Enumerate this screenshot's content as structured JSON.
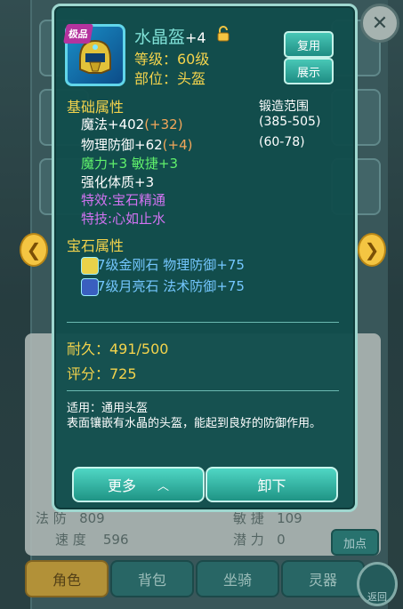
{
  "background": {
    "rows": [
      {
        "label": "法 防",
        "value": "809"
      },
      {
        "label": "速 度",
        "value": "596"
      },
      {
        "label": "敏 捷",
        "value": "109"
      },
      {
        "label": "潜 力",
        "value": "0"
      }
    ],
    "add_point_label": "加点",
    "tabs": [
      "角色",
      "背包",
      "坐骑",
      "灵器"
    ],
    "back_label": "返回"
  },
  "item": {
    "badge": "极品",
    "name": "水晶盔",
    "enhance": "+4",
    "level": "等级：60级",
    "slot": "部位：头盔",
    "buttons": {
      "copy": "复用",
      "show": "展示"
    }
  },
  "basic": {
    "title": "基础属性",
    "forge_title": "锻造范围",
    "magic": {
      "label": "魔法+402",
      "bonus": "(+32)",
      "range": "(385-505)"
    },
    "defense": {
      "label": "物理防御+62",
      "bonus": "(+4)",
      "range": "(60-78)"
    },
    "extra": "魔力+3 敏捷+3",
    "strengthen": "强化体质+3",
    "effect": "特效:宝石精通",
    "skill": "特技:心如止水"
  },
  "gems": {
    "title": "宝石属性",
    "items": [
      "7级金刚石 物理防御+75",
      "7级月亮石 法术防御+75"
    ]
  },
  "stats": {
    "durability": "耐久：491/500",
    "score": "评分：725"
  },
  "description": {
    "usage": "适用：通用头盔",
    "text": "表面镶嵌有水晶的头盔，能起到良好的防御作用。"
  },
  "actions": {
    "more": "更多",
    "unequip": "卸下"
  }
}
